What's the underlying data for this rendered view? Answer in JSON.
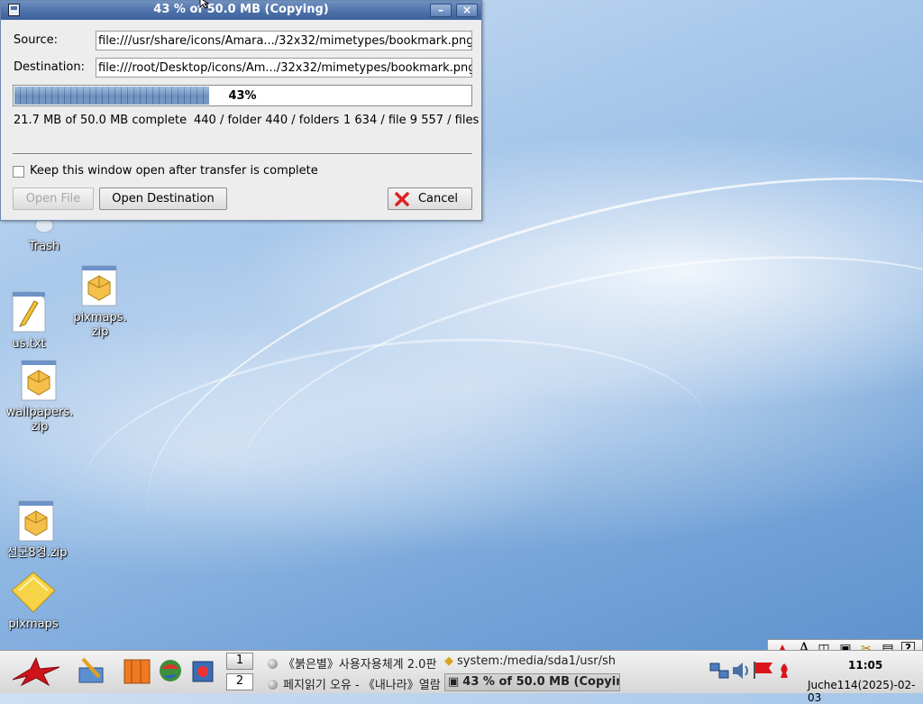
{
  "dialog": {
    "title": "43 % of 50.0 MB  (Copying)",
    "source_label": "Source:",
    "source_value": "file:///usr/share/icons/Amara.../32x32/mimetypes/bookmark.png",
    "destination_label": "Destination:",
    "destination_value": "file:///root/Desktop/icons/Am.../32x32/mimetypes/bookmark.png",
    "progress_percent": 43,
    "progress_label": "43%",
    "stat_size": "21.7 MB of 50.0 MB complete",
    "stat_folders": "440 / folder 440 / folders",
    "stat_files": "1 634 / file 9 557 / files",
    "keep_open_label": "Keep this window open after transfer is complete",
    "keep_open_checked": false,
    "open_file_label": "Open File",
    "open_destination_label": "Open Destination",
    "cancel_label": "Cancel"
  },
  "desktop_icons": [
    {
      "name": "Trash",
      "icon": "trash-icon"
    },
    {
      "name": "us.txt",
      "icon": "text-file-icon"
    },
    {
      "name": "pixmaps.\nzip",
      "icon": "zip-archive-icon"
    },
    {
      "name": "wallpapers.\nzip",
      "icon": "zip-archive-icon"
    },
    {
      "name": "선군8경.zip",
      "icon": "zip-archive-icon"
    },
    {
      "name": "pixmaps",
      "icon": "folder-icon"
    }
  ],
  "taskbar": {
    "pager": [
      "1",
      "2"
    ],
    "tasks": [
      "《붉은별》사용자용체계 2.0판",
      "system:/media/sda1/usr/sh",
      "페지읽기 오유 - 《내나라》열람",
      "43 % of 50.0 MB  (Copyin"
    ],
    "clock": "11:05",
    "date": "Juche114(2025)-02-03"
  },
  "colors": {
    "titlebar": "#4b6fa8",
    "progress_fill": "#5d85b8",
    "desktop": "#8fb7e3"
  }
}
